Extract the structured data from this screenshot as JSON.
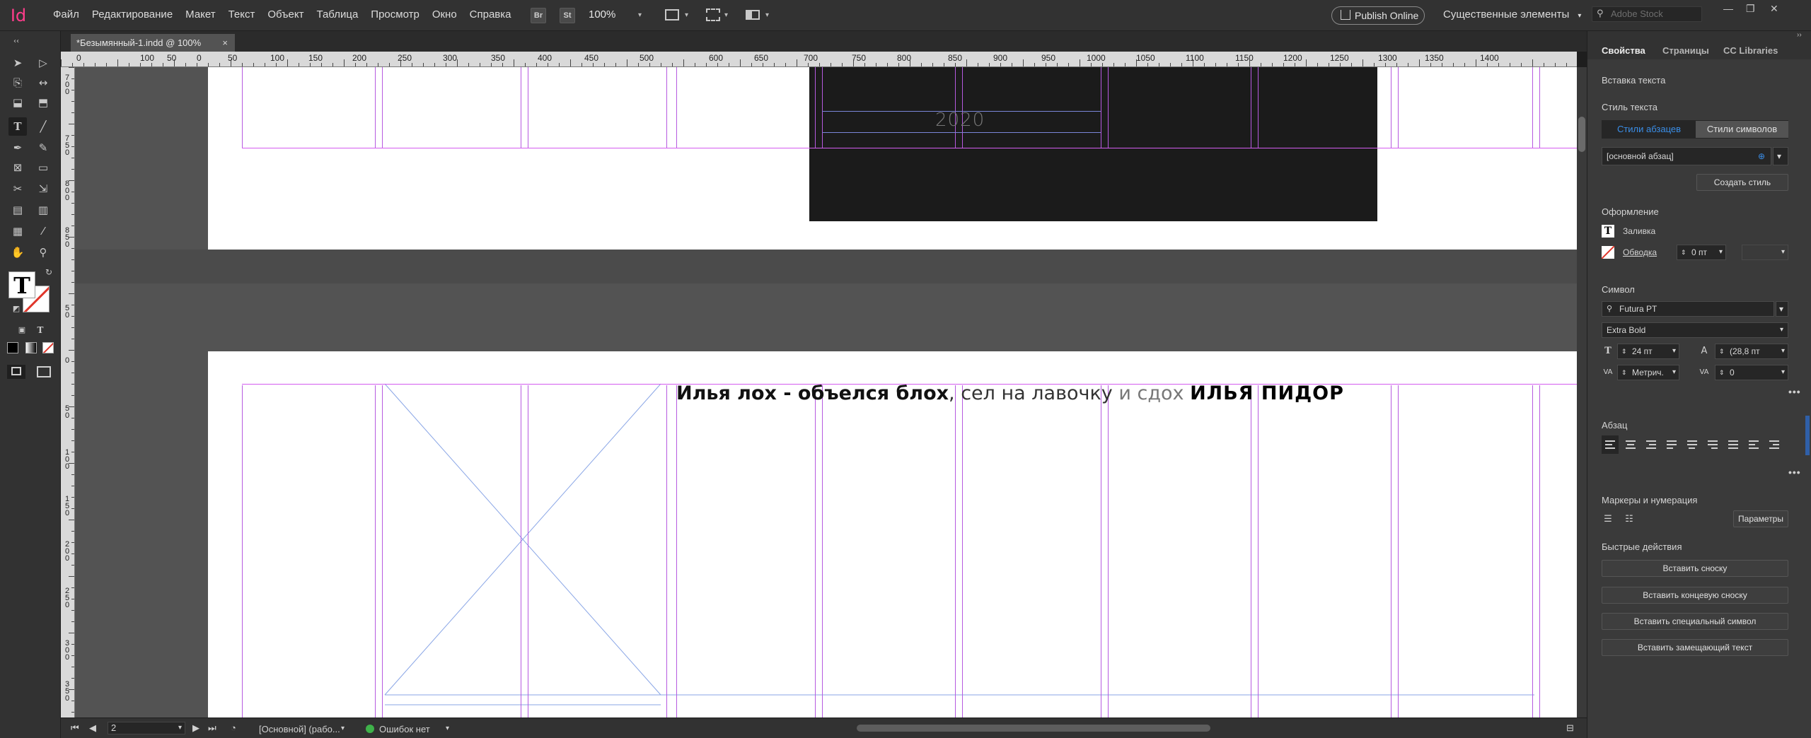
{
  "app": {
    "logo": "Id",
    "accent": "#ff3d8b"
  },
  "menu": [
    {
      "label": "Файл"
    },
    {
      "label": "Редактирование"
    },
    {
      "label": "Макет"
    },
    {
      "label": "Текст"
    },
    {
      "label": "Объект"
    },
    {
      "label": "Таблица"
    },
    {
      "label": "Просмотр"
    },
    {
      "label": "Окно"
    },
    {
      "label": "Справка"
    }
  ],
  "toolbar_top": {
    "br": "Br",
    "st": "St",
    "zoom": "100%"
  },
  "publish_label": "Publish Online",
  "workspace_label": "Существенные элементы",
  "stock_placeholder": "Adobe Stock",
  "document_tab": {
    "title": "*Безымянный-1.indd @ 100%",
    "close": "×"
  },
  "ruler_h_labels": [
    "0",
    "100",
    "50",
    "0",
    "50",
    "100",
    "150",
    "200",
    "250",
    "300",
    "350",
    "400",
    "450",
    "500",
    "600",
    "650",
    "700",
    "750",
    "800",
    "850",
    "900",
    "950",
    "1000",
    "1050",
    "1100",
    "1150",
    "1200",
    "1250",
    "1300",
    "1350",
    "1400"
  ],
  "ruler_v_labels": [
    "7 0 0",
    "7 5 0",
    "8 0 0",
    "8 5 0",
    "5 0",
    "0",
    "5 0",
    "1 0 0",
    "1 5 0",
    "2 0 0",
    "2 5 0",
    "3 0 0",
    "3 5 0"
  ],
  "canvas": {
    "year_text": "2020",
    "body_text": {
      "part1": "Илья лох - объелся блох",
      "part2": ", сел на лавочку",
      "part3": " и сдох ",
      "part4": "ИЛЬЯ ПИДОР"
    }
  },
  "statusbar": {
    "page": "2",
    "master": "[Основной] (рабо...",
    "errors": "Ошибок нет"
  },
  "panel": {
    "tabs": [
      "Свойства",
      "Страницы",
      "CC Libraries"
    ],
    "insert_text": "Вставка текста",
    "text_style": "Стиль текста",
    "para_styles": "Стили абзацев",
    "char_styles": "Стили символов",
    "base_para": "[основной абзац]",
    "create_style": "Создать стиль",
    "appearance": "Оформление",
    "fill": "Заливка",
    "stroke": "Обводка",
    "stroke_value": "0 пт",
    "symbol": "Символ",
    "font": "Futura PT",
    "font_style": "Extra Bold",
    "size": "24 пт",
    "leading": "(28,8 пт",
    "kerning": "Метрич.",
    "tracking": "0",
    "paragraph": "Абзац",
    "bullets": "Маркеры и нумерация",
    "params": "Параметры",
    "quick_actions": "Быстрые действия",
    "btn_footnote": "Вставить сноску",
    "btn_endnote": "Вставить концевую сноску",
    "btn_special": "Вставить специальный символ",
    "btn_placeholder": "Вставить замещающий текст"
  }
}
